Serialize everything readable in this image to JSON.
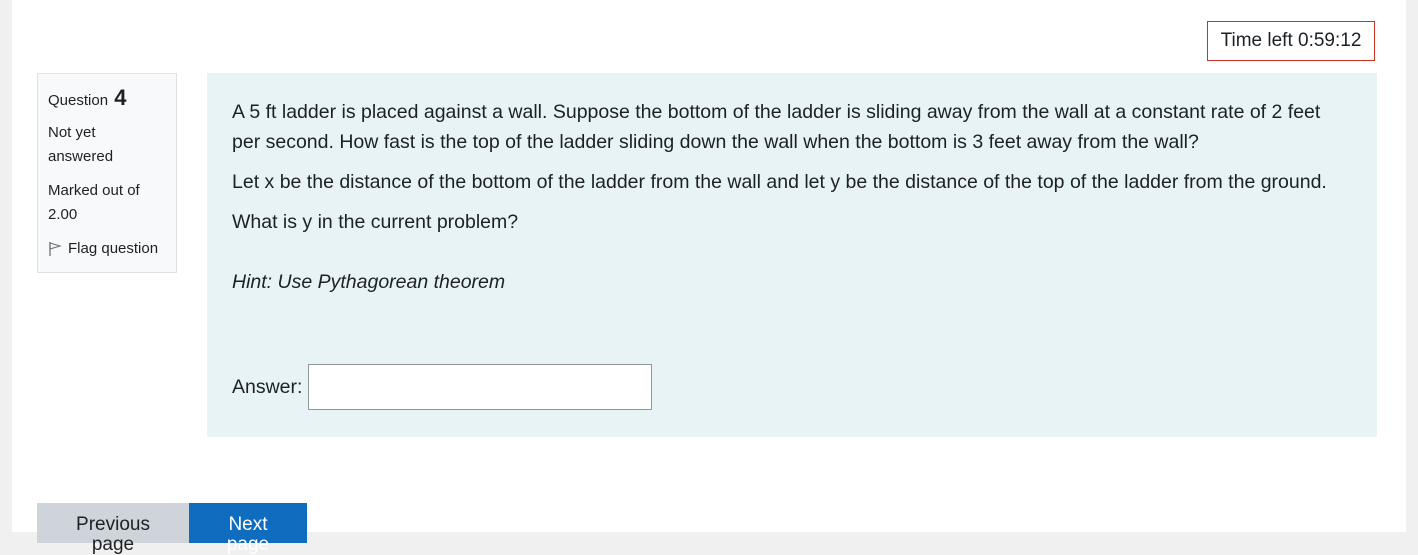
{
  "timer": {
    "label": "Time left 0:59:12"
  },
  "question_info": {
    "question_label": "Question",
    "question_number": "4",
    "state": "Not yet answered",
    "grade": "Marked out of 2.00",
    "flag_label": "Flag question"
  },
  "question": {
    "paragraphs": [
      "A 5 ft ladder is placed against a wall. Suppose the bottom of the ladder is sliding away from the wall at a constant rate of 2 feet per second. How fast is the top of the ladder sliding down the wall when the bottom is 3 feet away from the wall?",
      "Let x be the distance of the bottom of the ladder from the wall and let y be the distance of the top of the ladder from the ground.",
      "What is y in the current problem?"
    ],
    "hint": "Hint: Use Pythagorean theorem",
    "answer_label": "Answer:",
    "answer_value": ""
  },
  "navigation": {
    "previous_label": "Previous page",
    "next_label": "Next page"
  },
  "colors": {
    "timer_border": "#ca3120",
    "content_background": "#e7f3f5",
    "next_button": "#0f6cbf",
    "previous_button": "#ced4da"
  }
}
